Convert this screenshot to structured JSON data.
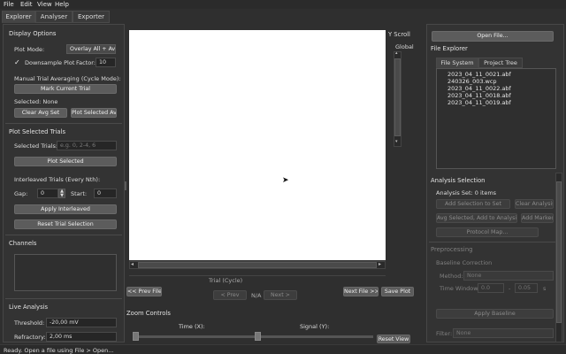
{
  "menu": [
    "File",
    "Edit",
    "View",
    "Help"
  ],
  "tabs": [
    "Explorer",
    "Analyser",
    "Exporter"
  ],
  "display_options": {
    "title": "Display Options",
    "plot_mode_label": "Plot Mode:",
    "plot_mode_value": "Overlay All + Avg",
    "downsample_label": "Downsample Plot",
    "factor_label": "Factor:",
    "factor_value": "10",
    "manual_avg_label": "Manual Trial Averaging (Cycle Mode):",
    "mark_current_trial": "Mark Current Trial",
    "selected_text": "Selected: None",
    "clear_avg_set": "Clear Avg Set",
    "plot_selected_avg": "Plot Selected Avg"
  },
  "plot_selected_trials": {
    "title": "Plot Selected Trials",
    "selected_trials_label": "Selected Trials:",
    "selected_trials_placeholder": "e.g. 0, 2-4, 6",
    "plot_selected": "Plot Selected",
    "interleaved_label": "Interleaved Trials (Every Nth):",
    "gap_label": "Gap:",
    "gap_value": "0",
    "start_label": "Start:",
    "start_value": "0",
    "apply_interleaved": "Apply Interleaved",
    "reset_selection": "Reset Trial Selection"
  },
  "channels": {
    "title": "Channels"
  },
  "live_analysis": {
    "title": "Live Analysis",
    "threshold_label": "Threshold:",
    "threshold_value": "-20,00 mV",
    "refractory_label": "Refractory:",
    "refractory_value": "2,00 ms"
  },
  "yscroll": {
    "title": "Y Scroll",
    "global_label": "Global"
  },
  "plot_controls": {
    "trial_label": "Trial (Cycle)",
    "prev_file": "<< Prev File",
    "prev": "< Prev",
    "trial_counter": "N/A",
    "next": "Next >",
    "next_file": "Next File >>",
    "save_plot": "Save Plot",
    "zoom_title": "Zoom Controls",
    "time_label": "Time (X):",
    "signal_label": "Signal (Y):",
    "reset_view": "Reset View"
  },
  "file_explorer": {
    "open_file": "Open File...",
    "title": "File Explorer",
    "tab_fs": "File System",
    "tab_pt": "Project Tree",
    "files": [
      "2023_04_11_0021.abf",
      "240326_003.wcp",
      "2023_04_11_0022.abf",
      "2023_04_11_0018.abf",
      "2023_04_11_0019.abf"
    ]
  },
  "analysis_selection": {
    "title": "Analysis Selection",
    "set_label": "Analysis Set: 0 items",
    "add_selection": "Add Selection to Set",
    "clear_analysis": "Clear Analysis Set",
    "avg_selected": "Avg Selected, Add to Analysis",
    "add_marked": "Add Marked",
    "protocol_map": "Protocol Map..."
  },
  "preprocessing": {
    "title": "Preprocessing",
    "baseline_title": "Baseline Correction",
    "method_label": "Method:",
    "method_value": "None",
    "time_window_label": "Time Window:",
    "tw_start": "0.0",
    "tw_sep": "-",
    "tw_end": "0.05",
    "tw_unit": "s",
    "apply_baseline": "Apply Baseline",
    "filter_label": "Filter:",
    "filter_value": "None"
  },
  "status": "Ready. Open a file using File > Open..."
}
